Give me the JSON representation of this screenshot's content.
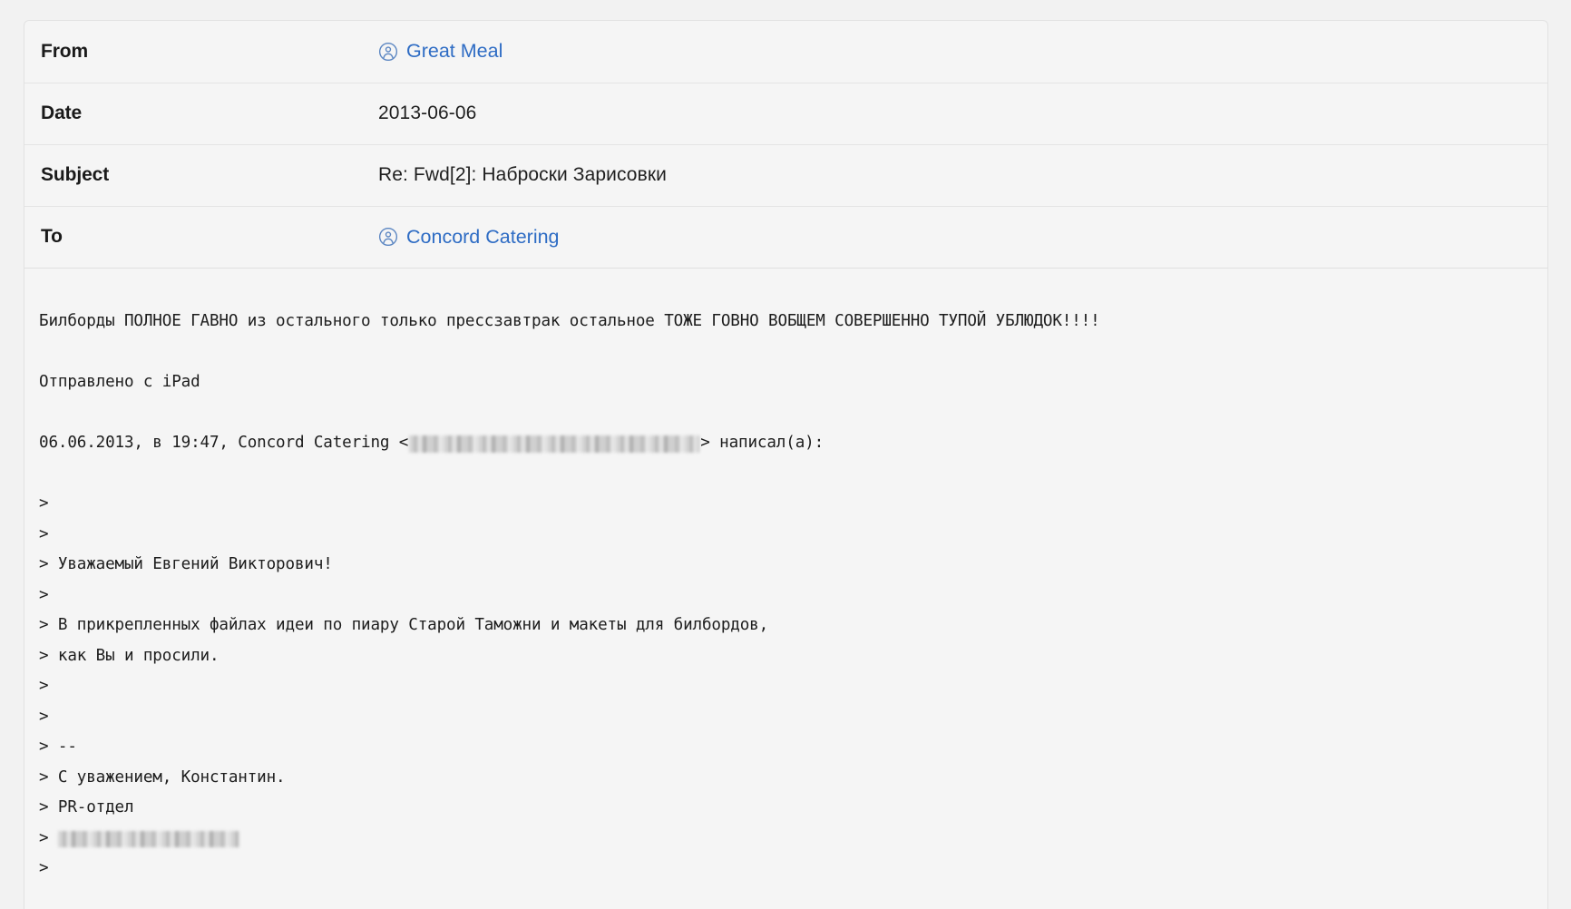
{
  "message": {
    "headers": [
      {
        "label": "From",
        "type": "contact",
        "value": "Great Meal"
      },
      {
        "label": "Date",
        "type": "text",
        "value": "2013-06-06"
      },
      {
        "label": "Subject",
        "type": "text",
        "value": "Re: Fwd[2]: Наброски Зарисовки"
      },
      {
        "label": "To",
        "type": "contact",
        "value": "Concord Catering"
      }
    ],
    "body_lines": [
      {
        "text": "Билборды ПОЛНОЕ ГАВНО из остального только прессзавтрак остальное ТОЖЕ ГОВНО ВОБЩЕМ СОВЕРШЕННО ТУПОЙ УБЛЮДОК!!!!"
      },
      {
        "text": ""
      },
      {
        "text": "Отправлено с iPad"
      },
      {
        "text": ""
      },
      {
        "text": "06.06.2013, в 19:47, Concord Catering <",
        "redaction": "inline-addr",
        "text_after": "> написал(а):"
      },
      {
        "text": ""
      },
      {
        "text": ">"
      },
      {
        "text": ">"
      },
      {
        "text": "> Уважаемый Евгений Викторович!"
      },
      {
        "text": ">"
      },
      {
        "text": "> В прикрепленных файлах идеи по пиару Старой Таможни и макеты для билбордов,"
      },
      {
        "text": "> как Вы и просили."
      },
      {
        "text": ">"
      },
      {
        "text": ">"
      },
      {
        "text": "> --"
      },
      {
        "text": "> С уважением, Константин."
      },
      {
        "text": "> PR-отдел"
      },
      {
        "text": "> ",
        "redaction": "sig-addr",
        "text_after": ""
      },
      {
        "text": ">"
      }
    ],
    "colors": {
      "link": "#2e6cc4",
      "page_background": "#f2f2f2",
      "card_background": "#f5f5f5",
      "row_border": "#e4e4e4",
      "body_text": "#1d1d1d"
    },
    "icons": {
      "contact_avatar": "person-circle-icon"
    }
  }
}
